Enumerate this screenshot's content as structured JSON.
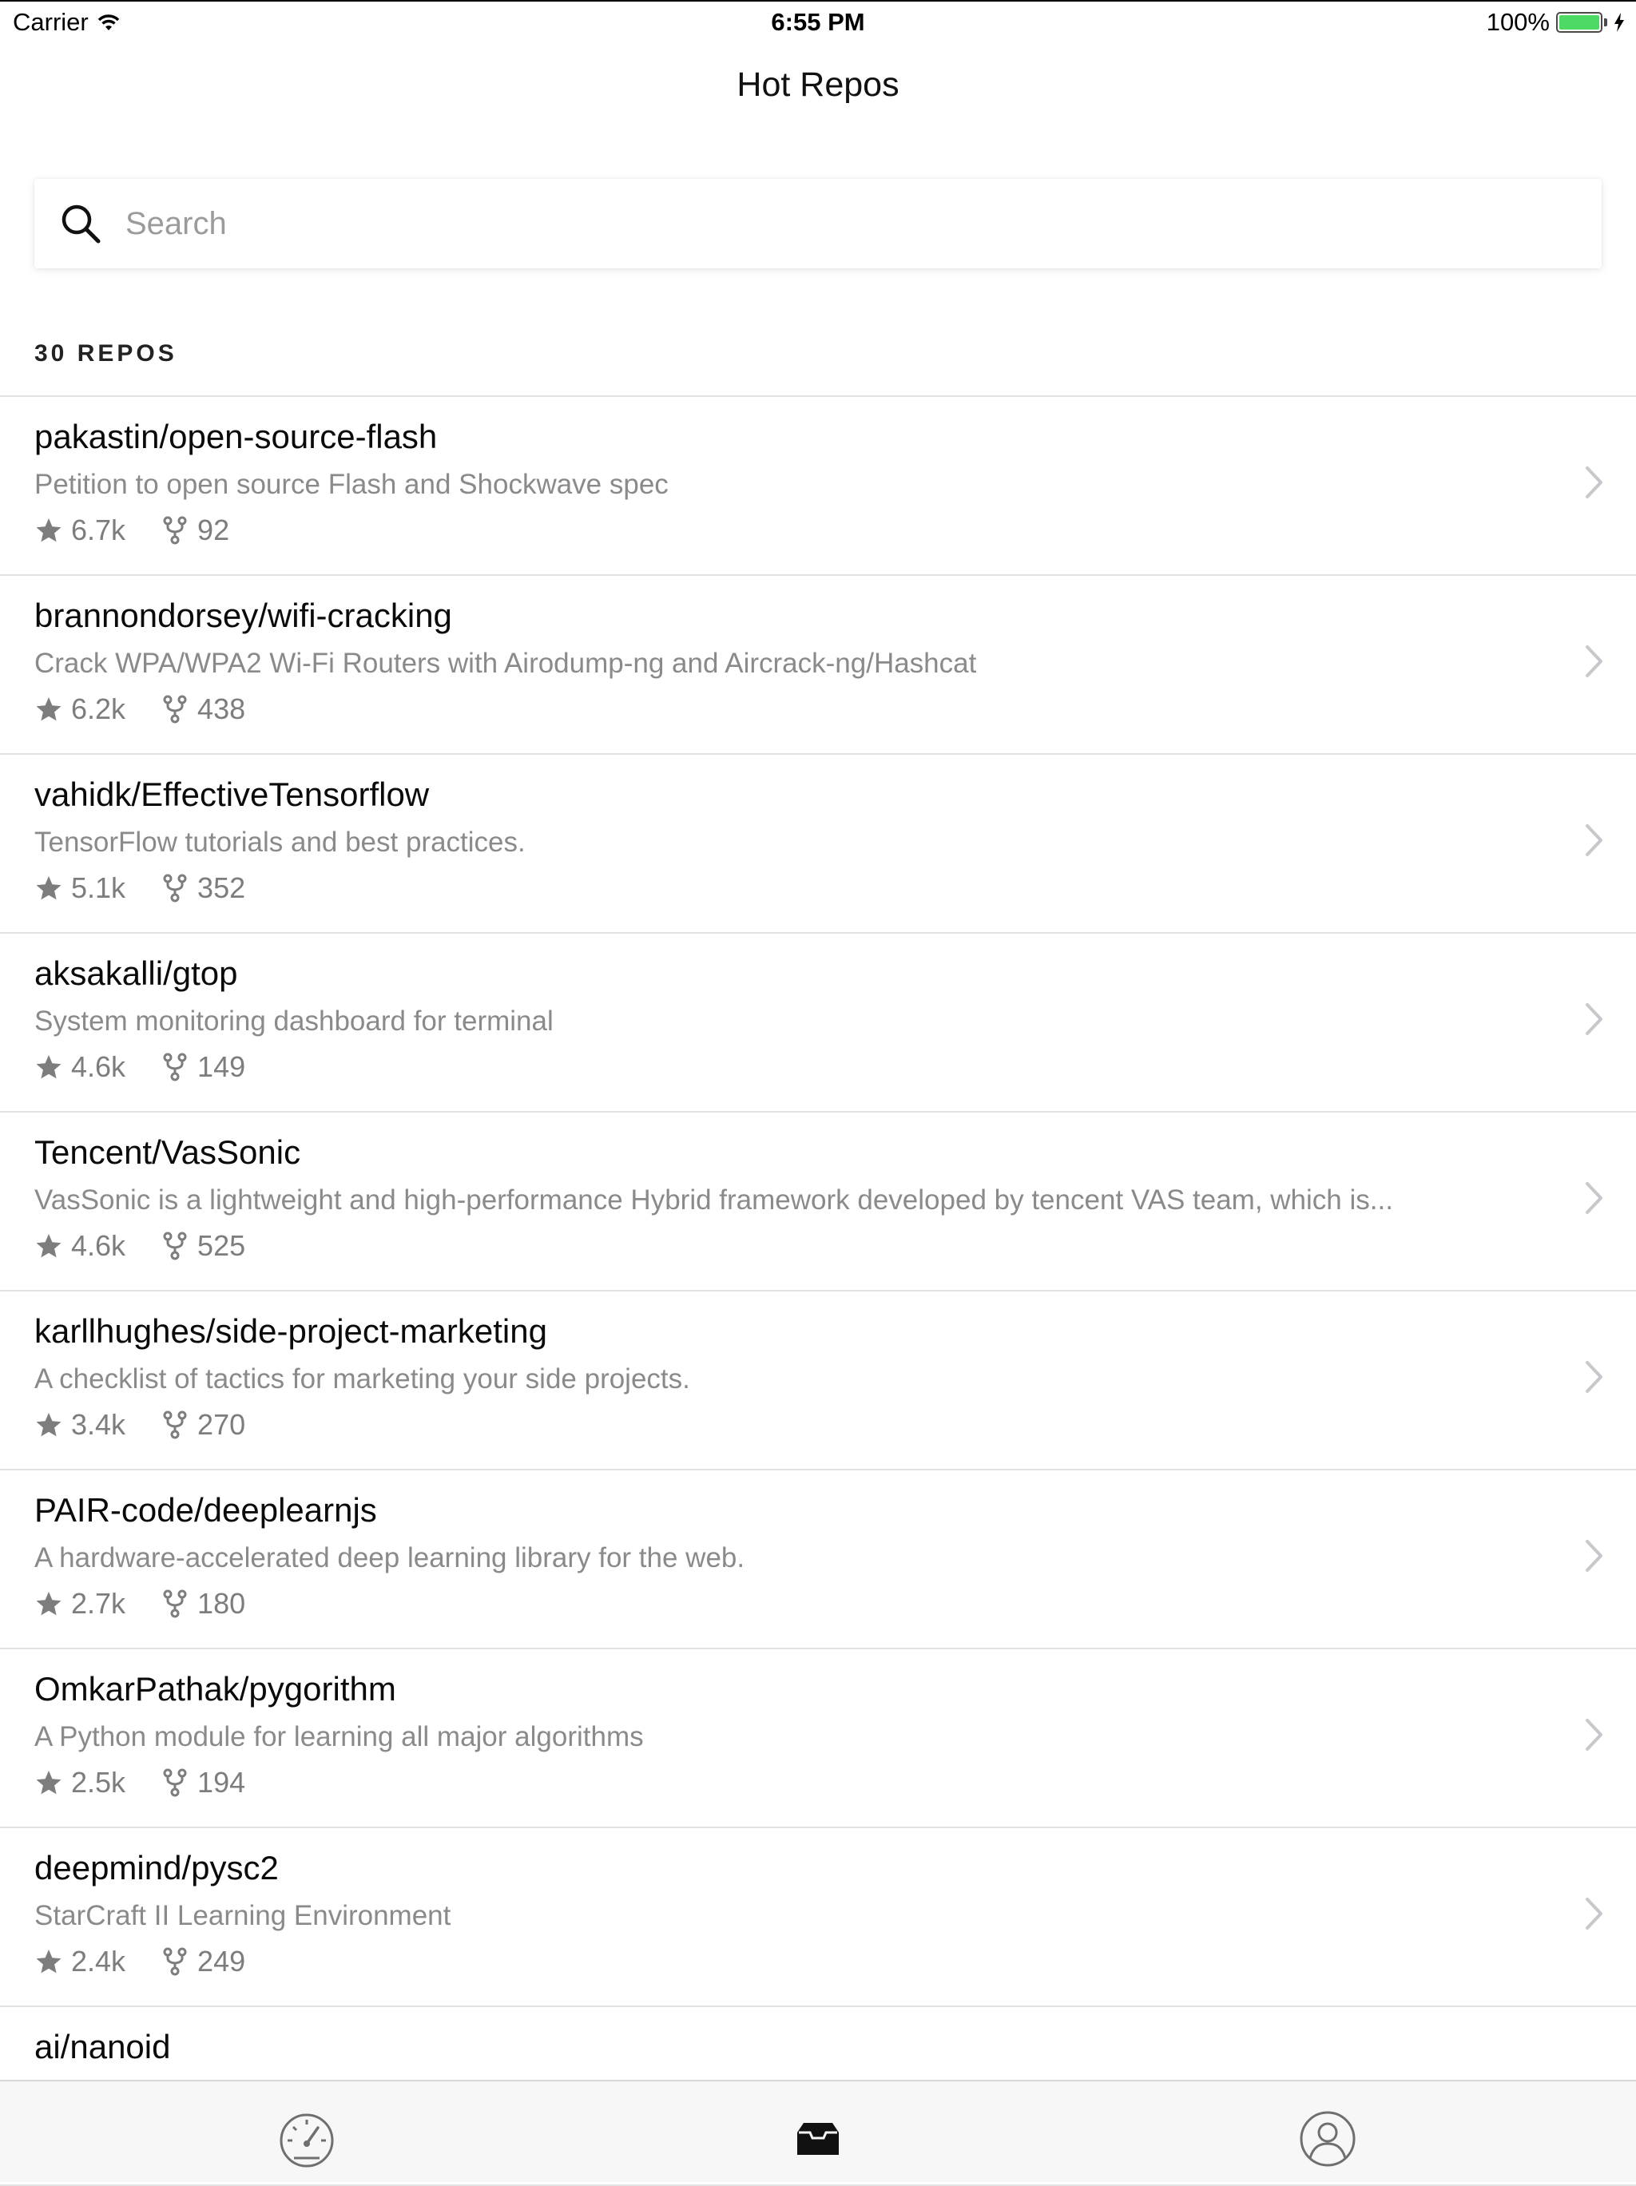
{
  "status_bar": {
    "carrier": "Carrier",
    "time": "6:55 PM",
    "battery": "100%",
    "battery_level": 1.0
  },
  "nav": {
    "title": "Hot Repos"
  },
  "search": {
    "placeholder": "Search",
    "value": ""
  },
  "section": {
    "header": "30 REPOS"
  },
  "repos": [
    {
      "name": "pakastin/open-source-flash",
      "description": "Petition to open source Flash and Shockwave spec",
      "stars": "6.7k",
      "forks": "92"
    },
    {
      "name": "brannondorsey/wifi-cracking",
      "description": "Crack WPA/WPA2 Wi-Fi Routers with Airodump-ng and Aircrack-ng/Hashcat",
      "stars": "6.2k",
      "forks": "438"
    },
    {
      "name": "vahidk/EffectiveTensorflow",
      "description": "TensorFlow tutorials and best practices.",
      "stars": "5.1k",
      "forks": "352"
    },
    {
      "name": "aksakalli/gtop",
      "description": "System monitoring dashboard for terminal",
      "stars": "4.6k",
      "forks": "149"
    },
    {
      "name": "Tencent/VasSonic",
      "description": "VasSonic is a lightweight and high-performance Hybrid framework developed by tencent VAS team, which is...",
      "stars": "4.6k",
      "forks": "525"
    },
    {
      "name": "karllhughes/side-project-marketing",
      "description": "A checklist of tactics for marketing your side projects.",
      "stars": "3.4k",
      "forks": "270"
    },
    {
      "name": "PAIR-code/deeplearnjs",
      "description": "A hardware-accelerated deep learning library for the web.",
      "stars": "2.7k",
      "forks": "180"
    },
    {
      "name": "OmkarPathak/pygorithm",
      "description": "A Python module for learning all major algorithms",
      "stars": "2.5k",
      "forks": "194"
    },
    {
      "name": "deepmind/pysc2",
      "description": "StarCraft II Learning Environment",
      "stars": "2.4k",
      "forks": "249"
    },
    {
      "name": "ai/nanoid",
      "description": "",
      "stars": "",
      "forks": ""
    }
  ],
  "tab_bar": {
    "tabs": [
      {
        "icon": "speedometer-icon"
      },
      {
        "icon": "inbox-tray-icon",
        "selected": true
      },
      {
        "icon": "user-profile-icon"
      }
    ]
  },
  "colors": {
    "background": "#ffffff",
    "secondary_text": "#8a8a8a",
    "divider": "#e3e3e3",
    "battery_green": "#4cd964",
    "tab_bar_bg": "#f7f7f7"
  }
}
